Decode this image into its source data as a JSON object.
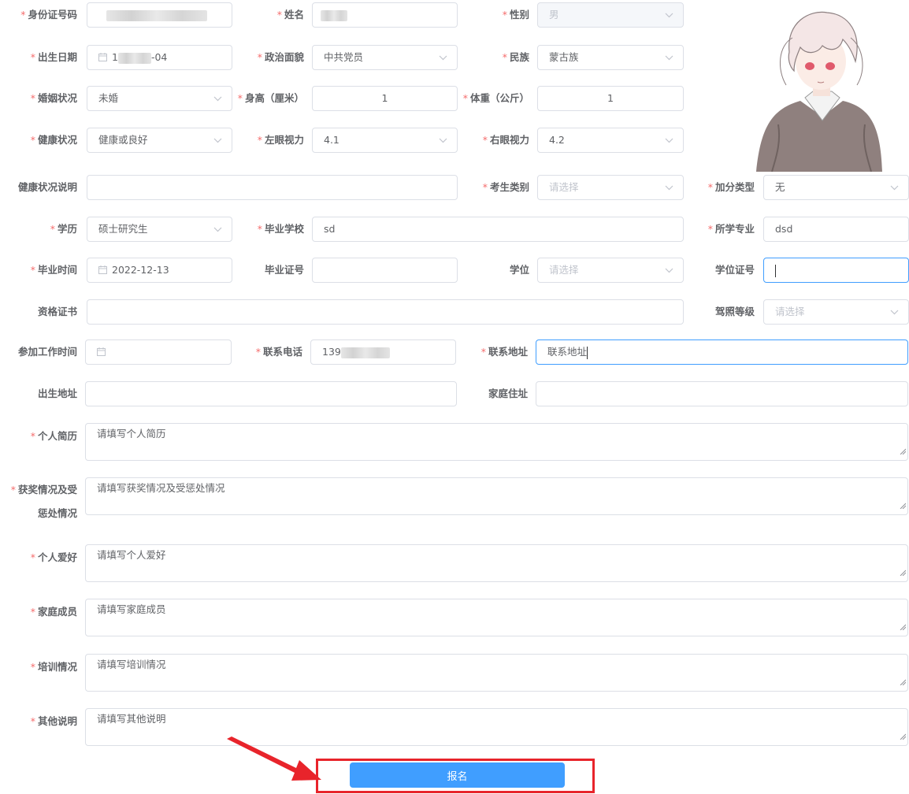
{
  "labels": {
    "id_number": "身份证号码",
    "name": "姓名",
    "gender": "性别",
    "birth_date": "出生日期",
    "political_status": "政治面貌",
    "ethnicity": "民族",
    "marital_status": "婚姻状况",
    "height": "身高（厘米）",
    "weight": "体重（公斤）",
    "health_status": "健康状况",
    "left_vision": "左眼视力",
    "right_vision": "右眼视力",
    "health_note": "健康状况说明",
    "candidate_type": "考生类别",
    "bonus_type": "加分类型",
    "education": "学历",
    "graduate_school": "毕业学校",
    "major": "所学专业",
    "graduation_date": "毕业时间",
    "diploma_no": "毕业证号",
    "degree": "学位",
    "degree_cert_no": "学位证号",
    "qualification_cert": "资格证书",
    "license_level": "驾照等级",
    "work_start_date": "参加工作时间",
    "phone": "联系电话",
    "address": "联系地址",
    "birth_place": "出生地址",
    "home_address": "家庭住址",
    "resume": "个人简历",
    "awards": "获奖情况及受惩处情况",
    "hobbies": "个人爱好",
    "family_members": "家庭成员",
    "training": "培训情况",
    "other_notes": "其他说明"
  },
  "values": {
    "gender": "男",
    "birth_date_suffix": "-04",
    "birth_date_prefix": "1",
    "political_status": "中共党员",
    "ethnicity": "蒙古族",
    "marital_status": "未婚",
    "height": "1",
    "weight": "1",
    "health_status": "健康或良好",
    "left_vision": "4.1",
    "right_vision": "4.2",
    "bonus_type": "无",
    "education": "硕士研究生",
    "graduate_school": "sd",
    "major": "dsd",
    "graduation_date": "2022-12-13",
    "phone_prefix": "139",
    "address": "联系地址"
  },
  "placeholders": {
    "select": "请选择",
    "resume": "请填写个人简历",
    "awards": "请填写获奖情况及受惩处情况",
    "hobbies": "请填写个人爱好",
    "family_members": "请填写家庭成员",
    "training": "请填写培训情况",
    "other_notes": "请填写其他说明"
  },
  "buttons": {
    "submit": "报名"
  },
  "colors": {
    "required": "#f56c6c",
    "primary": "#409eff",
    "highlight": "#e8242b",
    "border": "#dcdfe6"
  }
}
